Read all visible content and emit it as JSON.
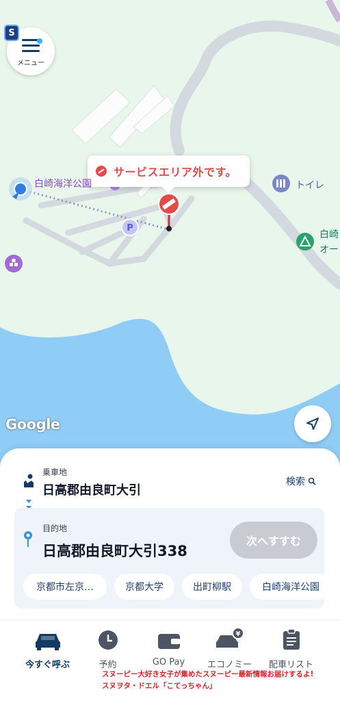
{
  "map": {
    "menu_label": "メニュー",
    "badge": "S",
    "tooltip_text": "サービスエリア外です。",
    "place_label": "白崎海洋公園",
    "toilet_label": "トイレ",
    "sea_label_1": "白崎",
    "sea_label_2": "オー",
    "google_logo": "Google",
    "icons": {
      "menu": "hamburger-icon",
      "current_location": "current-location-icon",
      "no_entry": "no-entry-pin-icon",
      "parking": "parking-icon",
      "toilet": "toilet-icon",
      "camp": "camp-icon",
      "facility": "facility-icon",
      "navigate": "navigation-arrow-icon"
    }
  },
  "pickup": {
    "label": "乗車地",
    "value": "日高郡由良町大引",
    "search_label": "検索"
  },
  "destination": {
    "label": "目的地",
    "value": "日高郡由良町大引338",
    "next_button": "次へすすむ"
  },
  "suggestions": [
    "京都市左京…",
    "京都大学",
    "出町柳駅",
    "白崎海洋公園"
  ],
  "tabs": [
    {
      "label": "今すぐ呼ぶ",
      "icon": "taxi-icon",
      "active": true
    },
    {
      "label": "予約",
      "icon": "clock-icon",
      "active": false
    },
    {
      "label": "GO Pay",
      "icon": "wallet-icon",
      "active": false
    },
    {
      "label": "エコノミー",
      "icon": "economy-car-icon",
      "active": false
    },
    {
      "label": "配車リスト",
      "icon": "clipboard-icon",
      "active": false
    }
  ],
  "promo": {
    "line1": "スヌーピー大好き女子が集めたスヌーピー最新情報お届けするよ!",
    "line2": "スヌヲタ・ドエル「こてっちゃん」"
  },
  "colors": {
    "land": "#e9f6ec",
    "water": "#8fcdf7",
    "road": "#d4d9df",
    "warning": "#e34a4a",
    "brand_navy": "#123a63",
    "disabled_button": "#c8ccd2"
  }
}
